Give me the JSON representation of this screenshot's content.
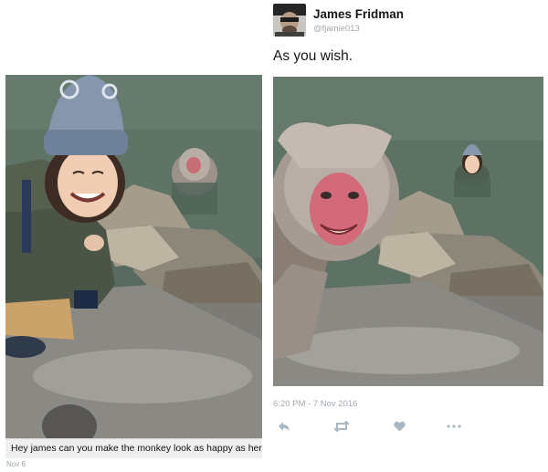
{
  "left_post": {
    "caption": "Hey james can you make the monkey look as happy as her?",
    "date": "Nov 6"
  },
  "tweet": {
    "display_name": "James Fridman",
    "handle": "@fjamie013",
    "text": "As you wish.",
    "timestamp": "6:20 PM - 7 Nov 2016"
  },
  "actions": [
    {
      "icon": "reply-icon"
    },
    {
      "icon": "retweet-icon"
    },
    {
      "icon": "like-icon"
    },
    {
      "icon": "more-icon"
    }
  ],
  "colors": {
    "name": "#14171a",
    "muted": "#a0a8af",
    "icon": "#aab8c2"
  }
}
